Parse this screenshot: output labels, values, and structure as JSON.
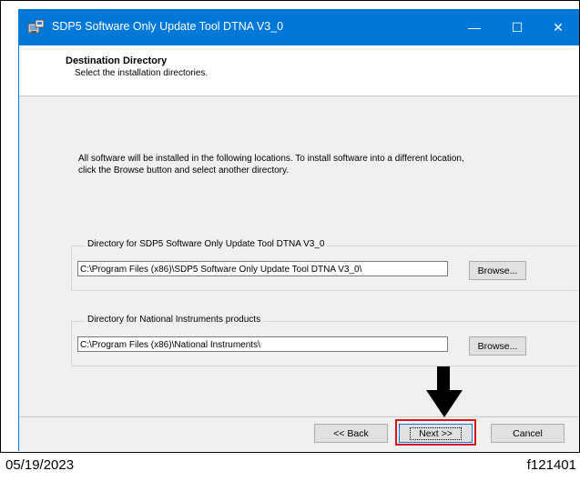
{
  "window": {
    "title": "SDP5 Software Only Update Tool DTNA V3_0",
    "minimize_glyph": "—",
    "maximize_glyph": "☐",
    "close_glyph": "✕"
  },
  "header": {
    "title": "Destination Directory",
    "subtitle": "Select the installation directories."
  },
  "body": {
    "info_text": "All software will be installed in the following locations. To install software into a different location, click the Browse button and select another directory."
  },
  "groups": [
    {
      "label": "Directory for SDP5 Software Only Update Tool DTNA V3_0",
      "path": "C:\\Program Files (x86)\\SDP5 Software Only Update Tool DTNA V3_0\\",
      "browse_label": "Browse..."
    },
    {
      "label": "Directory for National Instruments products",
      "path": "C:\\Program Files (x86)\\National Instruments\\",
      "browse_label": "Browse..."
    }
  ],
  "footer": {
    "back_label": "<< Back",
    "next_label": "Next >>",
    "cancel_label": "Cancel"
  },
  "annotation": {
    "highlight_color": "#d9141e",
    "arrow_icon": "down-arrow-icon"
  },
  "caption": {
    "date": "05/19/2023",
    "figure_id": "f121401"
  },
  "colors": {
    "titlebar": "#0078d7",
    "window_bg": "#f0f0f0"
  }
}
